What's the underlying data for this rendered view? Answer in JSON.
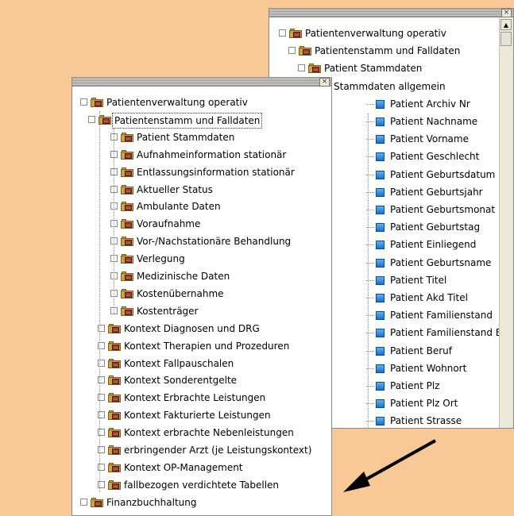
{
  "right_panel": {
    "close_label": "×",
    "scroll_up_label": "▲",
    "nodes": [
      {
        "label": "Patientenverwaltung operativ",
        "kind": "folder",
        "toggle": "−"
      },
      {
        "label": "Patientenstamm und Falldaten",
        "kind": "folder",
        "toggle": "−"
      },
      {
        "label": "Patient Stammdaten",
        "kind": "folder",
        "toggle": "−"
      },
      {
        "label": "Stammdaten allgemein",
        "kind": "folder",
        "toggle": "−"
      },
      {
        "label": "Patient Archiv Nr",
        "kind": "leaf"
      },
      {
        "label": "Patient Nachname",
        "kind": "leaf"
      },
      {
        "label": "Patient Vorname",
        "kind": "leaf"
      },
      {
        "label": "Patient Geschlecht",
        "kind": "leaf"
      },
      {
        "label": "Patient Geburtsdatum",
        "kind": "leaf"
      },
      {
        "label": "Patient Geburtsjahr",
        "kind": "leaf"
      },
      {
        "label": "Patient Geburtsmonat",
        "kind": "leaf"
      },
      {
        "label": "Patient Geburtstag",
        "kind": "leaf"
      },
      {
        "label": "Patient Einliegend",
        "kind": "leaf"
      },
      {
        "label": "Patient Geburtsname",
        "kind": "leaf"
      },
      {
        "label": "Patient Titel",
        "kind": "leaf"
      },
      {
        "label": "Patient Akd Titel",
        "kind": "leaf"
      },
      {
        "label": "Patient Familienstand",
        "kind": "leaf"
      },
      {
        "label": "Patient Familienstand B",
        "kind": "leaf"
      },
      {
        "label": "Patient Beruf",
        "kind": "leaf"
      },
      {
        "label": "Patient Wohnort",
        "kind": "leaf"
      },
      {
        "label": "Patient Plz",
        "kind": "leaf"
      },
      {
        "label": "Patient Plz Ort",
        "kind": "leaf"
      },
      {
        "label": "Patient Strasse",
        "kind": "leaf"
      }
    ]
  },
  "left_panel": {
    "close_label": "×",
    "nodes": [
      {
        "label": "Patientenverwaltung operativ",
        "toggle": "−"
      },
      {
        "label": "Patientenstamm und Falldaten",
        "toggle": "−",
        "selected": true
      },
      {
        "label": "Patient Stammdaten",
        "toggle": "+"
      },
      {
        "label": "Aufnahmeinformation stationär",
        "toggle": "+"
      },
      {
        "label": "Entlassungsinformation stationär",
        "toggle": "+"
      },
      {
        "label": "Aktueller Status",
        "toggle": "+"
      },
      {
        "label": "Ambulante Daten",
        "toggle": "+"
      },
      {
        "label": "Voraufnahme",
        "toggle": "+"
      },
      {
        "label": "Vor-/Nachstationäre Behandlung",
        "toggle": "+"
      },
      {
        "label": "Verlegung",
        "toggle": "+"
      },
      {
        "label": "Medizinische Daten",
        "toggle": "+"
      },
      {
        "label": "Kostenübernahme",
        "toggle": "+"
      },
      {
        "label": "Kostenträger",
        "toggle": "+"
      },
      {
        "label": "Kontext Diagnosen und DRG",
        "toggle": "+"
      },
      {
        "label": "Kontext Therapien und Prozeduren",
        "toggle": "+"
      },
      {
        "label": "Kontext Fallpauschalen",
        "toggle": "+"
      },
      {
        "label": "Kontext Sonderentgelte",
        "toggle": "+"
      },
      {
        "label": "Kontext Erbrachte Leistungen",
        "toggle": "+"
      },
      {
        "label": "Kontext Fakturierte Leistungen",
        "toggle": "+"
      },
      {
        "label": "Kontext erbrachte Nebenleistungen",
        "toggle": "+"
      },
      {
        "label": "erbringender Arzt (je Leistungskontext)",
        "toggle": "+"
      },
      {
        "label": "Kontext OP-Management",
        "toggle": "+"
      },
      {
        "label": "fallbezogen verdichtete Tabellen",
        "toggle": "+"
      },
      {
        "label": "Finanzbuchhaltung",
        "toggle": "+"
      }
    ]
  },
  "colors": {
    "background": "#F8C896",
    "arrow": "#000000",
    "leaf_icon": "#1a6fd0",
    "folder_icon": "#c9a640"
  }
}
